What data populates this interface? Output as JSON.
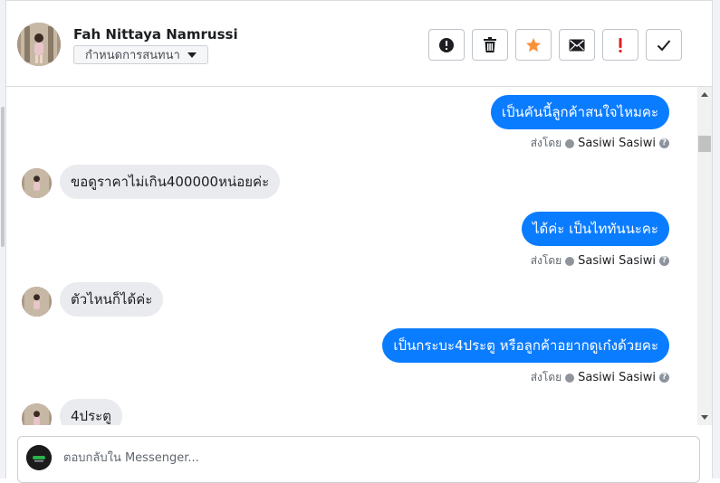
{
  "header": {
    "contact_name": "Fah Nittaya Namrussi",
    "assign_label": "กำหนดการสนทนา",
    "toolbar": [
      {
        "name": "mark-spam-button",
        "icon": "alert-circle-icon"
      },
      {
        "name": "delete-button",
        "icon": "trash-icon"
      },
      {
        "name": "star-button",
        "icon": "star-icon"
      },
      {
        "name": "mark-unread-button",
        "icon": "envelope-icon"
      },
      {
        "name": "follow-up-button",
        "icon": "exclamation-icon"
      },
      {
        "name": "mark-done-button",
        "icon": "check-icon"
      }
    ]
  },
  "messages": [
    {
      "direction": "out",
      "text": "เป็นคันนี้ลูกค้าสนใจไหมคะ",
      "sent_by_label": "ส่งโดย",
      "agent": "Sasiwi Sasiwi"
    },
    {
      "direction": "in",
      "text": "ขอดูราคาไม่เกิน400000หน่อยค่ะ"
    },
    {
      "direction": "out",
      "text": "ได้ค่ะ เป็นไททันนะคะ",
      "sent_by_label": "ส่งโดย",
      "agent": "Sasiwi Sasiwi"
    },
    {
      "direction": "in",
      "text": "ตัวไหนก็ได้ค่ะ"
    },
    {
      "direction": "out",
      "text": "เป็นกระบะ4ประตู หรือลูกค้าอยากดูเก๋งด้วยคะ",
      "sent_by_label": "ส่งโดย",
      "agent": "Sasiwi Sasiwi"
    },
    {
      "direction": "in",
      "text": "4ประตู"
    }
  ],
  "composer": {
    "placeholder": "ตอบกลับใน Messenger..."
  },
  "colors": {
    "outgoing_bubble": "#0a7cff",
    "incoming_bubble": "#e9ebee",
    "star": "#f7923b",
    "exclamation": "#e02020"
  }
}
